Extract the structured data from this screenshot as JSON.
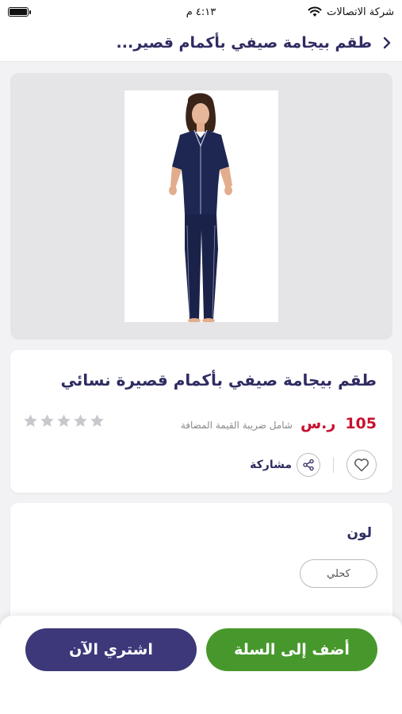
{
  "status_bar": {
    "carrier": "شركة الاتصالات",
    "time": "٤:١٣ م"
  },
  "nav": {
    "title": "طقم بيجامة صيفي بأكمام قصير..."
  },
  "product": {
    "name": "طقم بيجامة صيفي بأكمام قصيرة نسائي",
    "price": "105",
    "currency": "ر.س",
    "vat_note": "شامل ضريبة القيمة المضافة",
    "rating": 0,
    "rating_max": 5,
    "share_label": "مشاركة"
  },
  "options": {
    "color_title": "لون",
    "color_value": "كحلي"
  },
  "actions": {
    "add_to_cart": "أضف إلى السلة",
    "buy_now": "اشتري الآن"
  },
  "colors": {
    "brand_navy": "#2f2c62",
    "price_red": "#c8102e",
    "cart_green": "#47982c",
    "buy_purple": "#3c3879"
  }
}
